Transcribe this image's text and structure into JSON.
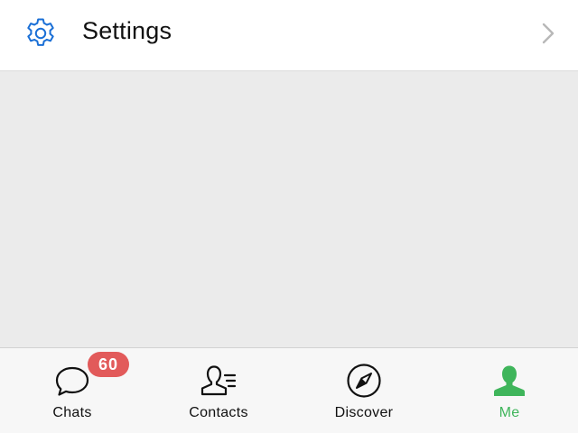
{
  "settings": {
    "label": "Settings",
    "icon": "gear-icon",
    "icon_color": "#1a6fd6"
  },
  "tabbar": {
    "active_color": "#3fb55b",
    "badge_color": "#e25a5a",
    "tabs": [
      {
        "label": "Chats",
        "icon": "chat-bubble-icon",
        "badge": "60"
      },
      {
        "label": "Contacts",
        "icon": "contacts-icon"
      },
      {
        "label": "Discover",
        "icon": "compass-icon"
      },
      {
        "label": "Me",
        "icon": "person-icon",
        "active": true
      }
    ]
  }
}
